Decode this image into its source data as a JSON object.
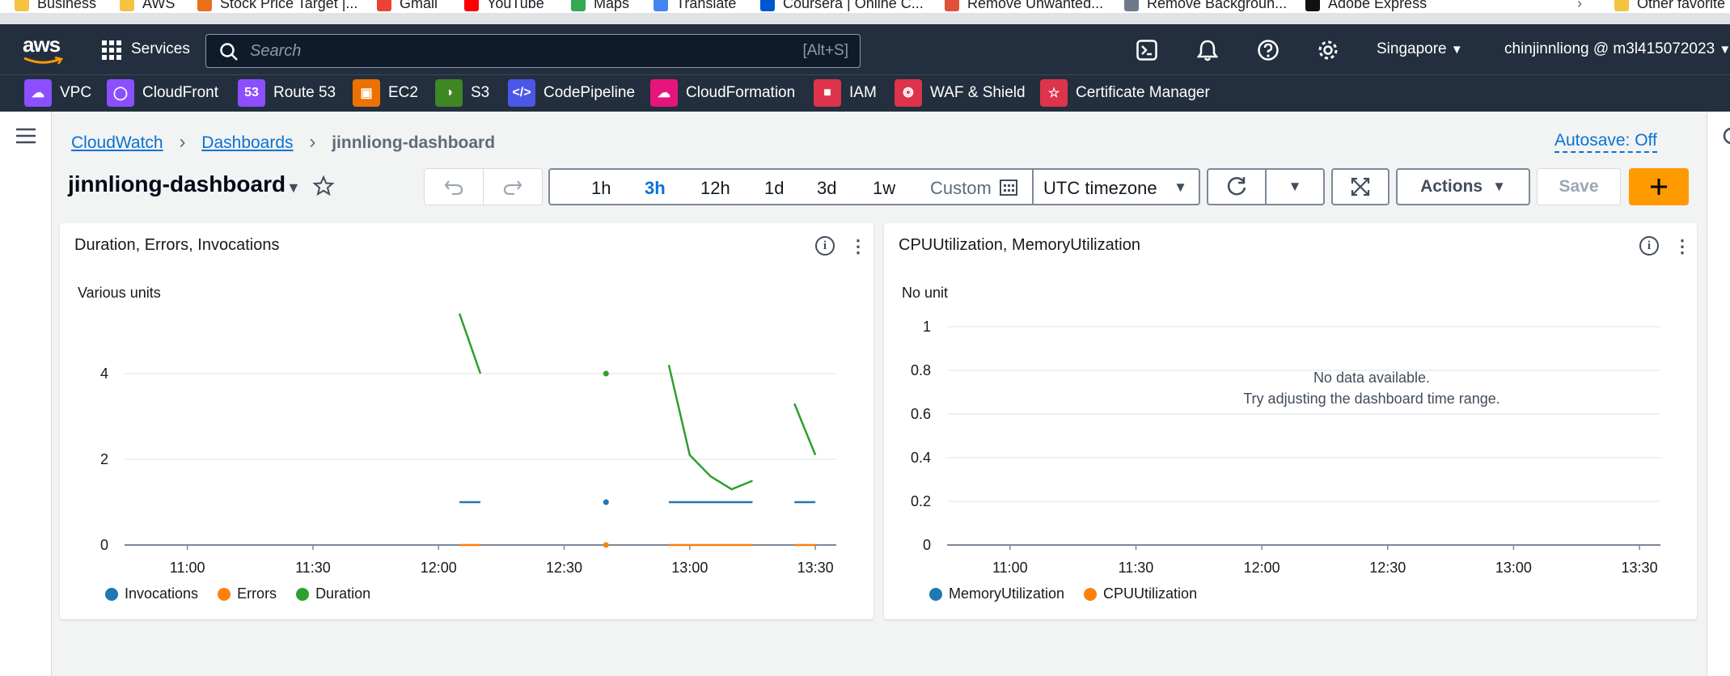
{
  "bookmarks": [
    "Business",
    "AWS",
    "Stock Price Target |...",
    "Gmail",
    "YouTube",
    "Maps",
    "Translate",
    "Coursera | Online C...",
    "Remove Unwanted...",
    "Remove Backgroun...",
    "Adobe Express",
    "Other favorite"
  ],
  "topnav": {
    "logo": "aws",
    "services": "Services",
    "search_placeholder": "Search",
    "search_shortcut": "[Alt+S]",
    "region": "Singapore",
    "account": "chinjinnliong @ m3l415072023"
  },
  "favorites": [
    "VPC",
    "CloudFront",
    "Route 53",
    "EC2",
    "S3",
    "CodePipeline",
    "CloudFormation",
    "IAM",
    "WAF & Shield",
    "Certificate Manager"
  ],
  "breadcrumb": {
    "item1": "CloudWatch",
    "item2": "Dashboards",
    "current": "jinnliong-dashboard"
  },
  "autosave": "Autosave: Off",
  "dashboard_title": "jinnliong-dashboard",
  "time_ranges": [
    "1h",
    "3h",
    "12h",
    "1d",
    "3d",
    "1w"
  ],
  "selected_range": "3h",
  "custom_label": "Custom",
  "timezone": "UTC timezone",
  "actions_label": "Actions",
  "save_label": "Save",
  "colors": {
    "blue": "#1f77b4",
    "orange": "#ff7f0e",
    "green": "#2ca02c",
    "accent": "#ff9900",
    "link": "#0972d3"
  },
  "widgets": [
    {
      "title": "Duration, Errors, Invocations",
      "unit_label": "Various units",
      "legend": [
        "Invocations",
        "Errors",
        "Duration"
      ]
    },
    {
      "title": "CPUUtilization, MemoryUtilization",
      "unit_label": "No unit",
      "no_data_line1": "No data available.",
      "no_data_line2": "Try adjusting the dashboard time range.",
      "legend": [
        "MemoryUtilization",
        "CPUUtilization"
      ]
    }
  ],
  "chart_data": [
    {
      "type": "line",
      "title": "Duration, Errors, Invocations",
      "ylabel": "Various units",
      "x_ticks": [
        "11:00",
        "11:30",
        "12:00",
        "12:30",
        "13:00",
        "13:30"
      ],
      "y_ticks": [
        "0",
        "2",
        "4"
      ],
      "ylim": [
        0,
        6
      ],
      "xlim": [
        "10:45",
        "13:35"
      ],
      "series": [
        {
          "name": "Invocations",
          "color": "#1f77b4",
          "segments": [
            [
              [
                "12:05",
                1
              ],
              [
                "12:10",
                1
              ]
            ],
            [
              [
                "12:40",
                1
              ]
            ],
            [
              [
                "12:55",
                1
              ],
              [
                "13:00",
                1
              ],
              [
                "13:05",
                1
              ],
              [
                "13:10",
                1
              ],
              [
                "13:15",
                1
              ]
            ],
            [
              [
                "13:25",
                1
              ],
              [
                "13:30",
                1
              ]
            ]
          ]
        },
        {
          "name": "Errors",
          "color": "#ff7f0e",
          "segments": [
            [
              [
                "12:05",
                0
              ],
              [
                "12:10",
                0
              ]
            ],
            [
              [
                "12:40",
                0
              ]
            ],
            [
              [
                "12:55",
                0
              ],
              [
                "13:00",
                0
              ],
              [
                "13:05",
                0
              ],
              [
                "13:10",
                0
              ],
              [
                "13:15",
                0
              ]
            ],
            [
              [
                "13:25",
                0
              ],
              [
                "13:30",
                0
              ]
            ]
          ]
        },
        {
          "name": "Duration",
          "color": "#2ca02c",
          "segments": [
            [
              [
                "12:05",
                5.4
              ],
              [
                "12:10",
                4.0
              ]
            ],
            [
              [
                "12:40",
                4.0
              ]
            ],
            [
              [
                "12:55",
                4.2
              ],
              [
                "13:00",
                2.1
              ],
              [
                "13:05",
                1.6
              ],
              [
                "13:10",
                1.3
              ],
              [
                "13:15",
                1.5
              ]
            ],
            [
              [
                "13:25",
                3.3
              ],
              [
                "13:30",
                2.1
              ]
            ]
          ]
        }
      ]
    },
    {
      "type": "line",
      "title": "CPUUtilization, MemoryUtilization",
      "ylabel": "No unit",
      "x_ticks": [
        "11:00",
        "11:30",
        "12:00",
        "12:30",
        "13:00",
        "13:30"
      ],
      "y_ticks": [
        "0",
        "0.2",
        "0.4",
        "0.6",
        "0.8",
        "1"
      ],
      "ylim": [
        0,
        1
      ],
      "xlim": [
        "10:45",
        "13:35"
      ],
      "series": [
        {
          "name": "MemoryUtilization",
          "color": "#1f77b4",
          "values": []
        },
        {
          "name": "CPUUtilization",
          "color": "#ff7f0e",
          "values": []
        }
      ]
    }
  ]
}
